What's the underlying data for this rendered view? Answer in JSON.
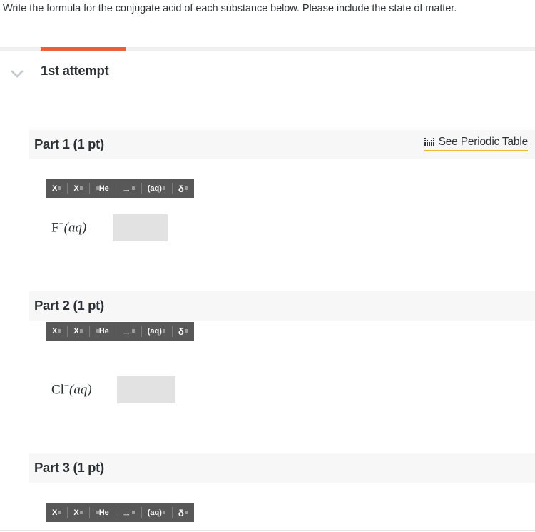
{
  "prompt": {
    "text": "Write the formula for the conjugate acid of each substance below. Please include the state of matter."
  },
  "attempt": {
    "label": "1st attempt",
    "chevron_icon": "chevron-down-icon",
    "active_tab_color": "#e8603c",
    "tabstrip_color": "#efefef"
  },
  "toolbar_buttons": [
    {
      "id": "superscript",
      "main": "X",
      "mark": "sup",
      "label": "superscript"
    },
    {
      "id": "subscript",
      "main": "X",
      "mark": "sub",
      "label": "subscript"
    },
    {
      "id": "isotope",
      "main": "He",
      "mark": "pre",
      "label": "isotope-prescript"
    },
    {
      "id": "arrow",
      "main": "→",
      "mark": "dot",
      "label": "reaction-arrow"
    },
    {
      "id": "state",
      "main": "(aq)",
      "mark": "dot",
      "label": "state-of-matter"
    },
    {
      "id": "delta",
      "main": "δ",
      "mark": "dot",
      "label": "partial-charge-delta"
    }
  ],
  "periodic_link": {
    "label": "See Periodic Table",
    "icon": "periodic-table-icon",
    "underline_color": "#e8b93c"
  },
  "parts": [
    {
      "title": "Part 1 (1 pt)",
      "points": "1 pt",
      "has_periodic_link": true,
      "formula": {
        "element": "F",
        "charge": "−",
        "state": "(aq)"
      },
      "answer_value": "",
      "answer_placeholder": "",
      "answer_width": 77,
      "visible": true
    },
    {
      "title": "Part 2 (1 pt)",
      "points": "1 pt",
      "has_periodic_link": false,
      "formula": {
        "element": "Cl",
        "charge": "−",
        "state": "(aq)"
      },
      "answer_value": "",
      "answer_placeholder": "",
      "answer_width": 82,
      "visible": true
    },
    {
      "title": "Part 3 (1 pt)",
      "points": "1 pt",
      "has_periodic_link": false,
      "formula": {
        "element": "",
        "charge": "",
        "state": ""
      },
      "answer_value": "",
      "answer_placeholder": "",
      "answer_width": 0,
      "visible": false
    }
  ],
  "colors": {
    "accent_orange": "#e8603c",
    "gold_underline": "#e8b93c",
    "toolbar_bg": "#585858",
    "part_header_bg": "#f7f7f7",
    "input_bg": "#e2e2e2",
    "text": "#2b3034"
  }
}
